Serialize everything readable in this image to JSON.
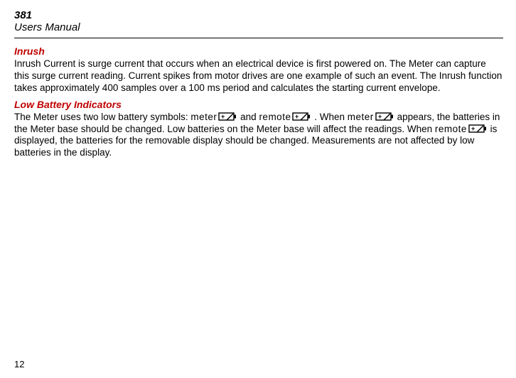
{
  "header": {
    "model": "381",
    "title": "Users Manual"
  },
  "sections": {
    "inrush": {
      "heading": "Inrush",
      "body": "Inrush Current is surge current that occurs when an electrical device is first powered on. The Meter can capture this surge current reading. Current spikes from motor drives are one example of such an event. The Inrush function takes approximately 400 samples over a 100 ms period and calculates the starting current envelope."
    },
    "lowbat": {
      "heading": "Low Battery Indicators",
      "p1a": "The Meter uses two low battery symbols:",
      "lbl_meter1": "meter",
      "p1b": "and",
      "lbl_remote1": "remote",
      "p1c": ". When",
      "lbl_meter2": "meter",
      "p2a": "appears, the batteries in the Meter base should be changed. Low batteries on the Meter base will affect the readings. When",
      "lbl_remote2": "remote",
      "p2b": " is displayed, the batteries for the removable display should be changed. Measurements are not affected by low batteries in the display."
    }
  },
  "page_number": "12"
}
